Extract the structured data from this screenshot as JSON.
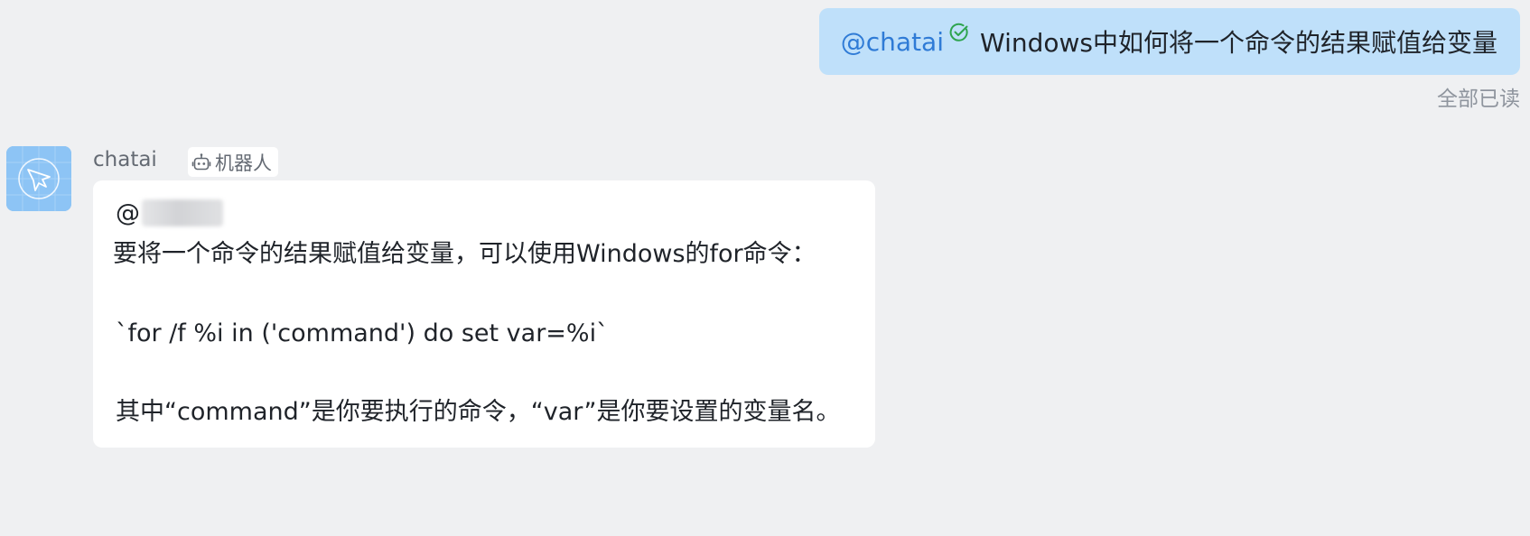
{
  "outgoing": {
    "mention": "@chatai",
    "text": "Windows中如何将一个命令的结果赋值给变量",
    "read_status": "全部已读",
    "read_icon": "check-circle-icon"
  },
  "incoming": {
    "sender": "chatai",
    "avatar_icon": "bot-avatar-icon",
    "tag_icon": "robot-icon",
    "tag_label": "机器人",
    "mention_at": "@",
    "lines": [
      " 要将一个命令的结果赋值给变量，可以使用Windows的for命令：",
      "`for /f %i in ('command') do set var=%i`",
      "其中“command”是你要执行的命令，“var”是你要设置的变量名。"
    ]
  },
  "colors": {
    "background": "#eff0f2",
    "outgoing_bubble": "#bfe0fa",
    "mention": "#2f7bd6",
    "read_check": "#2ea44f",
    "incoming_bubble": "#ffffff",
    "avatar": "#8dc4f5"
  }
}
